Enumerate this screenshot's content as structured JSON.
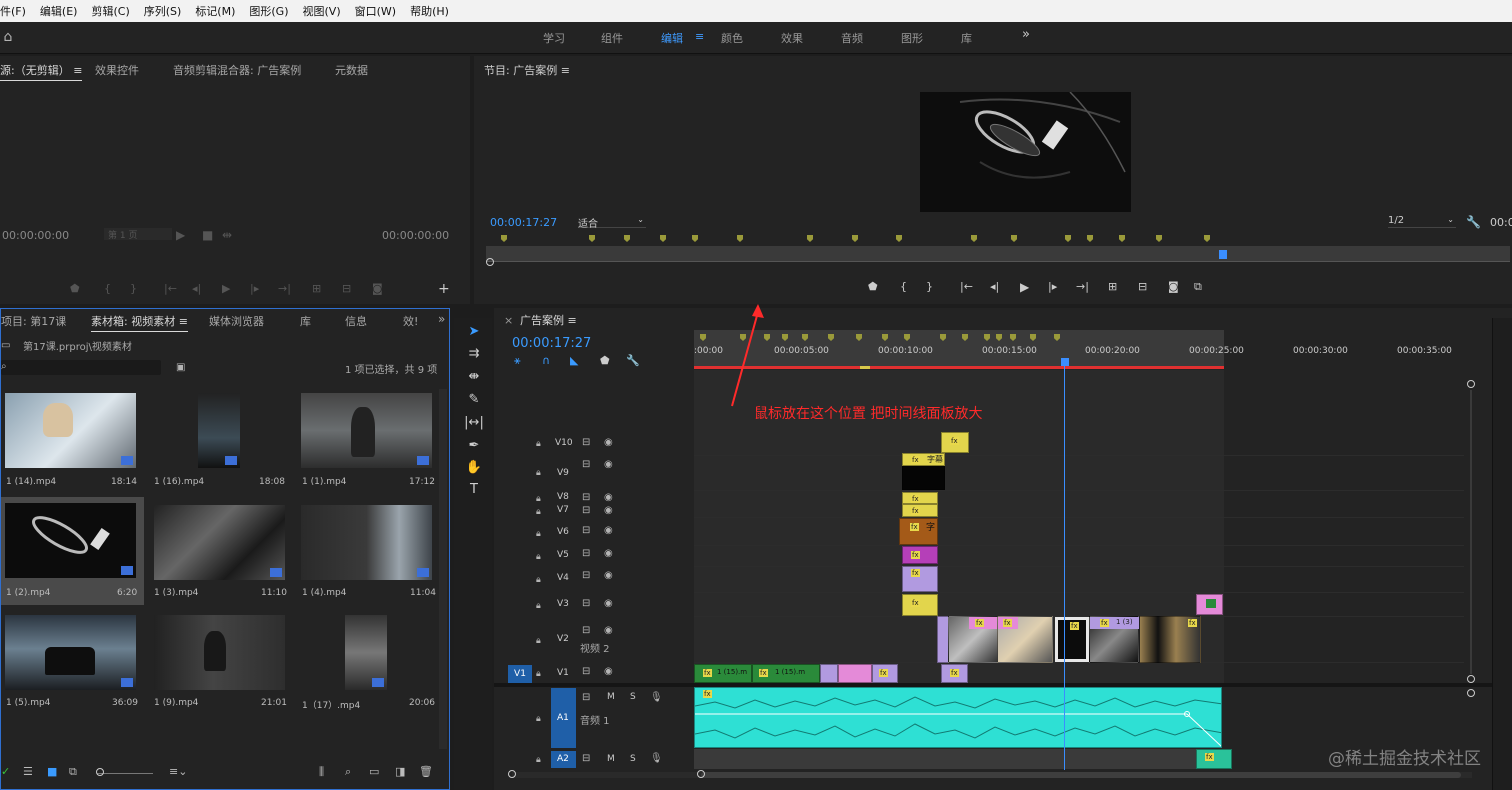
{
  "menu": [
    "件(F)",
    "编辑(E)",
    "剪辑(C)",
    "序列(S)",
    "标记(M)",
    "图形(G)",
    "视图(V)",
    "窗口(W)",
    "帮助(H)"
  ],
  "workspaces": {
    "items": [
      "学习",
      "组件",
      "编辑",
      "颜色",
      "效果",
      "音频",
      "图形",
      "库"
    ],
    "active": "编辑",
    "more": "»"
  },
  "source_panel": {
    "tabs": [
      "源:（无剪辑）",
      "效果控件",
      "音频剪辑混合器: 广告案例",
      "元数据"
    ],
    "tc_left": "00:00:00:00",
    "page_select": "第 1 页",
    "tc_right": "00:00:00:00"
  },
  "program_panel": {
    "title": "节目: 广告案例",
    "timecode": "00:00:17:27",
    "fit": "适合",
    "resolution": "1/2",
    "tc_right": "00:00"
  },
  "project_panel": {
    "tabs": [
      "项目: 第17课",
      "素材箱: 视频素材",
      "媒体浏览器",
      "库",
      "信息",
      "效!"
    ],
    "path": "第17课.prproj\\视频素材",
    "selection_status": "1 项已选择，共 9 项",
    "items": [
      {
        "name": "1 (14).mp4",
        "dur": "18:14"
      },
      {
        "name": "1 (16).mp4",
        "dur": "18:08"
      },
      {
        "name": "1 (1).mp4",
        "dur": "17:12"
      },
      {
        "name": "1 (2).mp4",
        "dur": "6:20"
      },
      {
        "name": "1 (3).mp4",
        "dur": "11:10"
      },
      {
        "name": "1 (4).mp4",
        "dur": "11:04"
      },
      {
        "name": "1 (5).mp4",
        "dur": "36:09"
      },
      {
        "name": "1 (9).mp4",
        "dur": "21:01"
      },
      {
        "name": "1（17）.mp4",
        "dur": "20:06"
      }
    ]
  },
  "timeline": {
    "title": "广告案例",
    "timecode": "00:00:17:27",
    "ruler": [
      ":00:00",
      "00:00:05:00",
      "00:00:10:00",
      "00:00:15:00",
      "00:00:20:00",
      "00:00:25:00",
      "00:00:30:00",
      "00:00:35:00"
    ],
    "tracks_video": [
      "V10",
      "V9",
      "V8",
      "V7",
      "V6",
      "V5",
      "V4",
      "V3",
      "V2",
      "V1"
    ],
    "v2_name": "视频 2",
    "tracks_audio": [
      "A1",
      "A2"
    ],
    "a1_name": "音频 1",
    "annotation": "鼠标放在这个位置 把时间线面板放大",
    "clip_labels": {
      "caption": "字幕",
      "char": "字",
      "c13": "1 (3)",
      "c151": "1 (15).m",
      "c151b": "1 (15).m"
    }
  },
  "watermark": "@稀土掘金技术社区",
  "colors": {
    "accent": "#3a9bff",
    "annotation": "#ff2a2a",
    "audio": "#2ee0d4"
  }
}
